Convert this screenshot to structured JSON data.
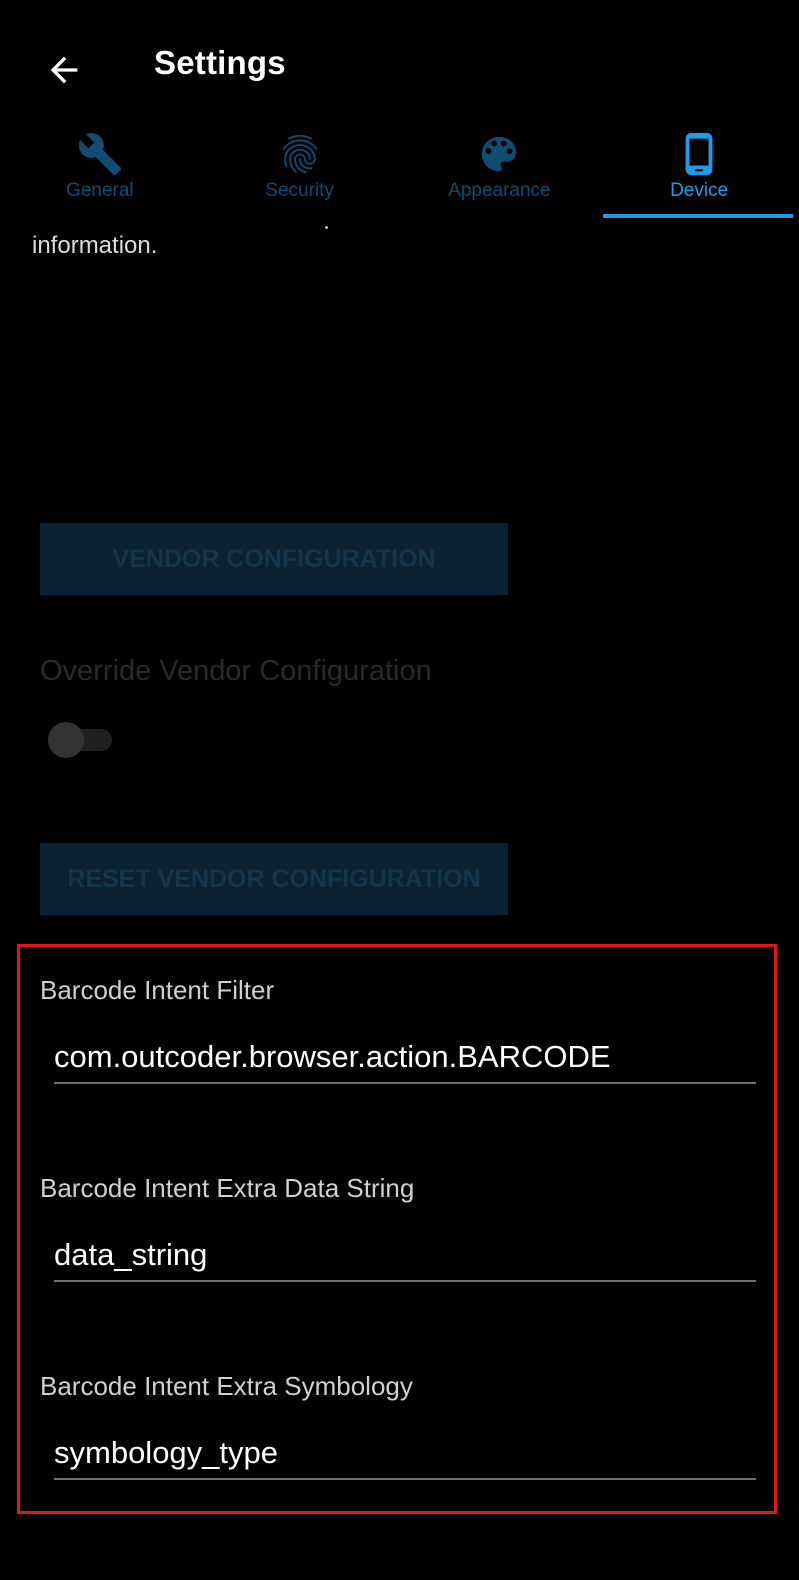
{
  "app_bar": {
    "title": "Settings",
    "back_icon": "arrow-left-icon"
  },
  "tabs": [
    {
      "label": "General",
      "icon": "wrench-icon",
      "active": false
    },
    {
      "label": "Security",
      "icon": "fingerprint-icon",
      "active": false
    },
    {
      "label": "Appearance",
      "icon": "palette-icon",
      "active": false
    },
    {
      "label": "Device",
      "icon": "phone-icon",
      "active": true
    }
  ],
  "colors": {
    "accent": "#1e9ce9",
    "highlight_border": "#e3171a",
    "background": "#000000"
  },
  "content": {
    "truncated_text": "information.",
    "vendor_configuration_button": "VENDOR CONFIGURATION",
    "override_vendor_label": "Override Vendor Configuration",
    "override_vendor_enabled": false,
    "reset_vendor_button": "RESET VENDOR CONFIGURATION"
  },
  "barcode_fields": [
    {
      "label": "Barcode Intent Filter",
      "value": "com.outcoder.browser.action.BARCODE"
    },
    {
      "label": "Barcode Intent Extra Data String",
      "value": "data_string"
    },
    {
      "label": "Barcode Intent Extra Symbology",
      "value": "symbology_type"
    }
  ]
}
